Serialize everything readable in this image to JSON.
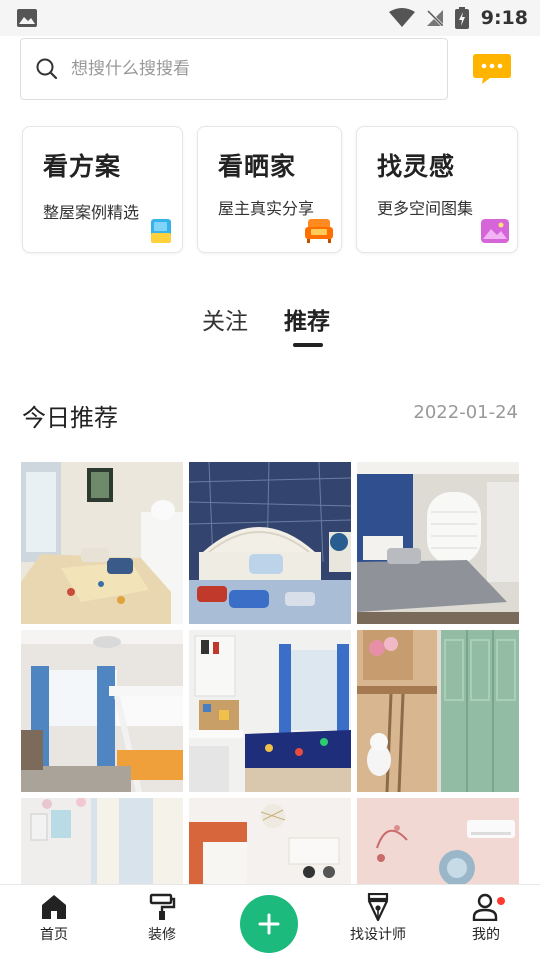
{
  "status_bar": {
    "time": "9:18",
    "icons": [
      "image-notification-icon",
      "wifi-icon",
      "no-signal-icon",
      "battery-charging-icon"
    ]
  },
  "search": {
    "placeholder": "想搜什么搜搜看",
    "icon": "search-icon",
    "message_icon": "chat-bubble-icon",
    "message_color": "#ffb400"
  },
  "entry_cards": [
    {
      "title": "看方案",
      "subtitle": "整屋案例精选",
      "icon": "notebook-icon"
    },
    {
      "title": "看晒家",
      "subtitle": "屋主真实分享",
      "icon": "sofa-icon"
    },
    {
      "title": "找灵感",
      "subtitle": "更多空间图集",
      "icon": "gallery-icon"
    }
  ],
  "feed_tabs": {
    "items": [
      "关注",
      "推荐"
    ],
    "active": "推荐"
  },
  "today": {
    "title": "今日推荐",
    "date": "2022-01-24"
  },
  "photos": [
    {
      "subject": "bedroom-map-bedding",
      "colors": [
        "#e9e3d4",
        "#5b7aa0"
      ]
    },
    {
      "subject": "kids-room-navy-wallpaper",
      "colors": [
        "#3a4d78",
        "#b7c7d8"
      ]
    },
    {
      "subject": "grey-bedroom-blue-wall",
      "colors": [
        "#d8d6d2",
        "#2f4f8f"
      ]
    },
    {
      "subject": "bunk-bed-blue-curtains",
      "colors": [
        "#e7e4de",
        "#5b8ec4"
      ]
    },
    {
      "subject": "study-bed-window-seat",
      "colors": [
        "#efefef",
        "#3a6ec7"
      ]
    },
    {
      "subject": "loft-bed-green-wardrobe",
      "colors": [
        "#c8a98a",
        "#8db5a0"
      ]
    },
    {
      "subject": "girls-room-white-curtains",
      "colors": [
        "#f1f0ef",
        "#dcdcdc"
      ]
    },
    {
      "subject": "orange-curtain-room",
      "colors": [
        "#f3efec",
        "#d8663d"
      ]
    },
    {
      "subject": "pink-mural-room",
      "colors": [
        "#f2d9d6",
        "#c96b6b"
      ]
    }
  ],
  "bottom_nav": {
    "accent": "#1dba7d",
    "items": [
      {
        "label": "首页",
        "icon": "home-icon"
      },
      {
        "label": "装修",
        "icon": "paint-roller-icon"
      },
      {
        "label": "",
        "icon": "plus-icon"
      },
      {
        "label": "找设计师",
        "icon": "pen-nib-icon"
      },
      {
        "label": "我的",
        "icon": "user-icon"
      }
    ]
  }
}
